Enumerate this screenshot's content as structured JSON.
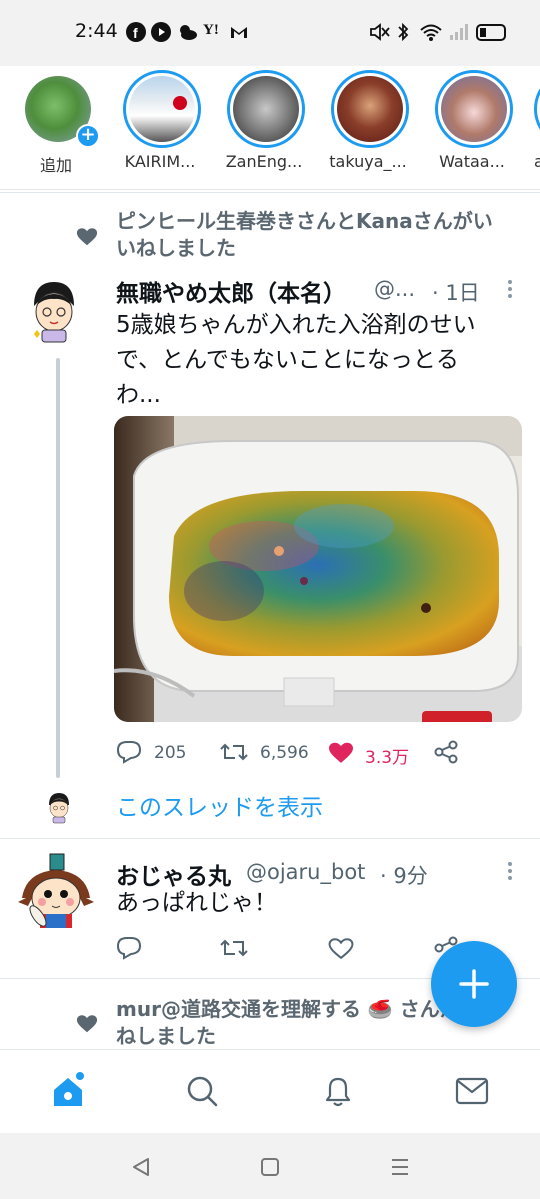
{
  "status_bar": {
    "time": "2:44",
    "icons": [
      "facebook-icon",
      "youtube-icon",
      "weather-icon",
      "yahoo-icon",
      "gmail-icon",
      "mute-icon",
      "bluetooth-icon",
      "wifi-icon",
      "signal-icon",
      "battery-icon"
    ],
    "yahoo_text": "Y!"
  },
  "fleets": [
    {
      "name": "追加",
      "ring": false
    },
    {
      "name": "KAIRIM...",
      "ring": true
    },
    {
      "name": "ZanEng...",
      "ring": true
    },
    {
      "name": "takuya_...",
      "ring": true
    },
    {
      "name": "Wataa...",
      "ring": true
    },
    {
      "name": "a",
      "ring": true
    }
  ],
  "tweet1": {
    "context_line1": "ピンヒール生春巻きさんとKanaさんがい",
    "context_line2": "いねしました",
    "name": "無職やめ太郎（本名）",
    "handle": "@...",
    "time": "· 1日",
    "text_line1": "5歳娘ちゃんが入れた入浴剤のせい",
    "text_line2": "で、とんでもないことになっとる",
    "text_line3": "わ...",
    "replies": "205",
    "retweets": "6,596",
    "likes": "3.3万",
    "liked": true,
    "show_thread": "このスレッドを表示"
  },
  "tweet2": {
    "name": "おじゃる丸",
    "handle": "@ojaru_bot",
    "time": "· 9分",
    "text": "あっぱれじゃ！"
  },
  "tweet3": {
    "context_line1": "mur@道路交通を理解する",
    "context_emoji": "🥌",
    "context_suffix": "さんがい",
    "context_line2": "ねしました"
  },
  "colors": {
    "accent": "#1d9bf0",
    "like": "#e0245e",
    "secondary_text": "#536471"
  },
  "bottom_nav": [
    "home-icon",
    "search-icon",
    "notifications-icon",
    "messages-icon"
  ],
  "system_nav": [
    "back-icon",
    "home-square-icon",
    "recents-icon"
  ]
}
